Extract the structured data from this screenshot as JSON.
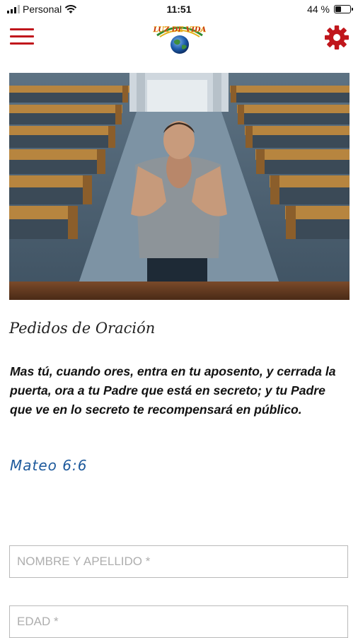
{
  "status_bar": {
    "carrier": "Personal",
    "time": "11:51",
    "battery": "44 %",
    "battery_level": 0.44,
    "icons": [
      "signal-icon",
      "wifi-icon",
      "battery-icon"
    ]
  },
  "header": {
    "logo_text": "LUZ DE VIDA",
    "icons": [
      "hamburger-menu-icon",
      "gear-icon"
    ],
    "accent_color": "#c0161c"
  },
  "hero": {
    "subject": "man-praying-in-church-photo"
  },
  "content": {
    "title": "Pedidos de Oración",
    "verse": "Mas tú, cuando ores, entra en tu aposento, y cerrada la puerta, ora a tu Padre que está en secreto; y tu Padre que ve en lo secreto te recompensará en público.",
    "reference": "Mateo 6:6",
    "reference_color": "#1e5a9c"
  },
  "form": {
    "name_placeholder": "NOMBRE Y APELLIDO *",
    "name_value": "",
    "age_placeholder": "EDAD *",
    "age_value": ""
  }
}
